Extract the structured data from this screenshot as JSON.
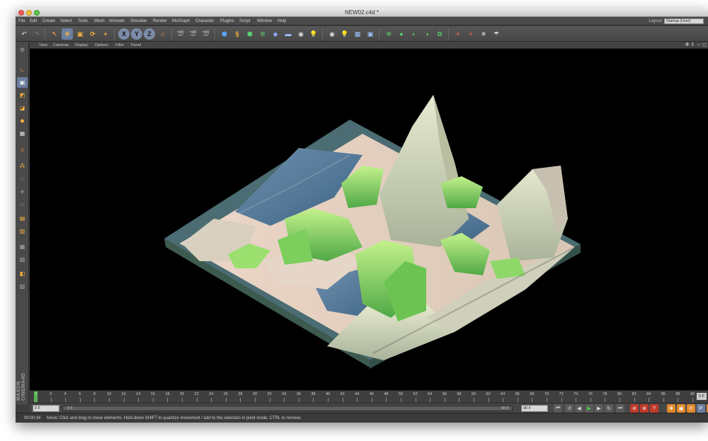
{
  "window": {
    "title": "NEW02.c4d *"
  },
  "menu": [
    "File",
    "Edit",
    "Create",
    "Select",
    "Tools",
    "Mesh",
    "Animate",
    "Simulate",
    "Render",
    "MoGraph",
    "Character",
    "Plugins",
    "Script",
    "Window",
    "Help"
  ],
  "layout": {
    "label": "Layout:",
    "value": "Startup (User)"
  },
  "toolbar": {
    "axes": [
      "X",
      "Y",
      "Z"
    ]
  },
  "viewport_menu": [
    "View",
    "Cameras",
    "Display",
    "Options",
    "Filter",
    "Panel"
  ],
  "timeline": {
    "ticks": [
      "0",
      "2",
      "4",
      "6",
      "8",
      "10",
      "12",
      "14",
      "16",
      "18",
      "20",
      "22",
      "24",
      "26",
      "28",
      "30",
      "32",
      "34",
      "36",
      "38",
      "40",
      "42",
      "44",
      "46",
      "48",
      "50",
      "52",
      "54",
      "56",
      "58",
      "60",
      "62",
      "64",
      "66",
      "68",
      "70",
      "72",
      "74",
      "76",
      "78",
      "80",
      "82",
      "84",
      "86",
      "88",
      "90"
    ],
    "end_frame": "0 F"
  },
  "controls": {
    "current_frame": "0 F",
    "range_start": "0 F",
    "range_end": "90 F",
    "max_frame": "90 F"
  },
  "brand": {
    "text": "MAXON CINEMA4D"
  },
  "status": {
    "time": "00:00:34",
    "message": "Move: Click and drag to move elements. Hold down SHIFT to quantize movement / add to the selection in point mode, CTRL to remove."
  }
}
